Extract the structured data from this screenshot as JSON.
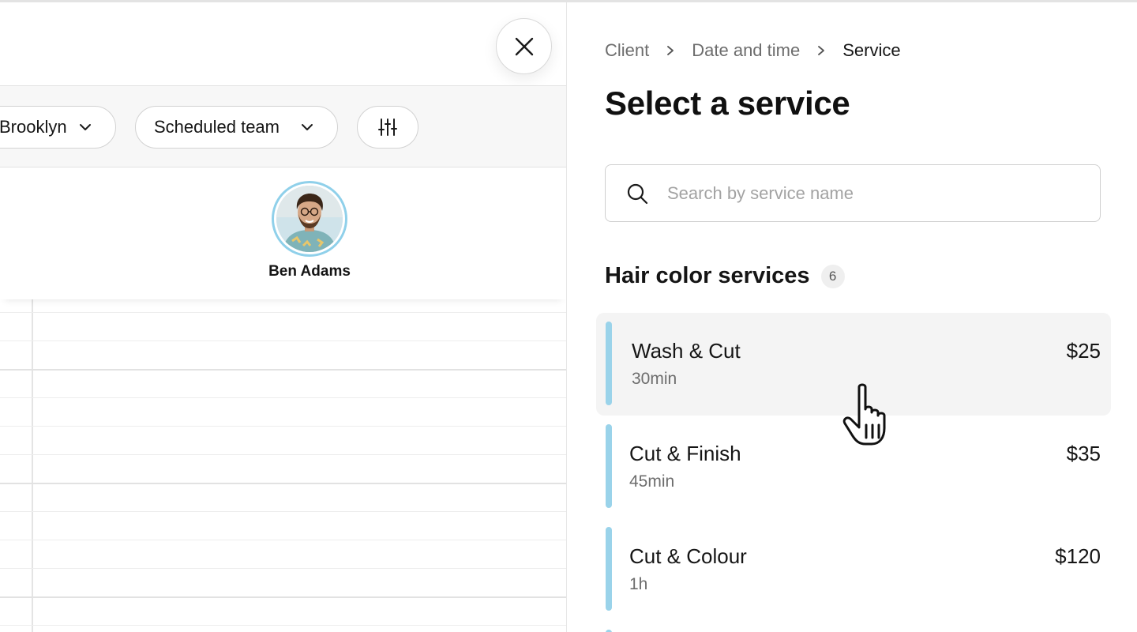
{
  "calendar": {
    "filters": {
      "location": "Brooklyn",
      "team": "Scheduled team"
    },
    "staff": [
      {
        "name": "Ben Adams"
      }
    ]
  },
  "panel": {
    "breadcrumb": [
      "Client",
      "Date and time",
      "Service"
    ],
    "title": "Select a service",
    "search": {
      "placeholder": "Search by service name",
      "value": ""
    },
    "section": {
      "title": "Hair color services",
      "count": "6"
    },
    "services": [
      {
        "name": "Wash & Cut",
        "duration": "30min",
        "price": "$25"
      },
      {
        "name": "Cut & Finish",
        "duration": "45min",
        "price": "$35"
      },
      {
        "name": "Cut & Colour",
        "duration": "1h",
        "price": "$120"
      }
    ]
  },
  "icons": {
    "close": "close-icon",
    "chevron": "chevron-down-icon",
    "filter": "sliders-icon",
    "search": "search-icon",
    "breadcrumb_sep": "chevron-right-icon",
    "cursor": "hand-pointer-icon"
  },
  "colors": {
    "accent": "#9ad3ea",
    "avatar_ring": "#8fd0ea",
    "hover_row": "#f4f4f4"
  }
}
